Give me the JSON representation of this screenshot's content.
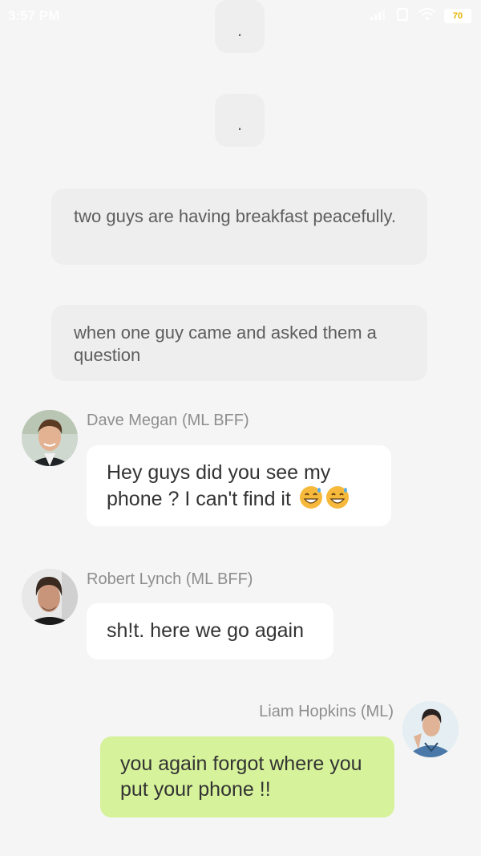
{
  "status_bar": {
    "time": "3:57 PM",
    "signal_icon": "signal-icon",
    "wifi_icon": "wifi-icon",
    "battery_level": "70"
  },
  "narration": [
    {
      "text": "."
    },
    {
      "text": "."
    },
    {
      "text": "two guys are having breakfast peacefully."
    },
    {
      "text": "when one guy came and asked them a question"
    }
  ],
  "messages": [
    {
      "sender": "Dave Megan (ML BFF)",
      "text": "Hey guys did you see my phone ? I can't find it",
      "emoji": "grinning-sweat-emoji",
      "side": "left"
    },
    {
      "sender": "Robert Lynch (ML BFF)",
      "text": "sh!t. here we go again",
      "side": "left"
    },
    {
      "sender": "Liam Hopkins (ML)",
      "text": "you again forgot where you put your phone !!",
      "side": "right"
    }
  ],
  "colors": {
    "background": "#f5f5f5",
    "narration_bubble": "#eeeeee",
    "incoming_bubble": "#ffffff",
    "outgoing_bubble": "#d6f29a"
  }
}
